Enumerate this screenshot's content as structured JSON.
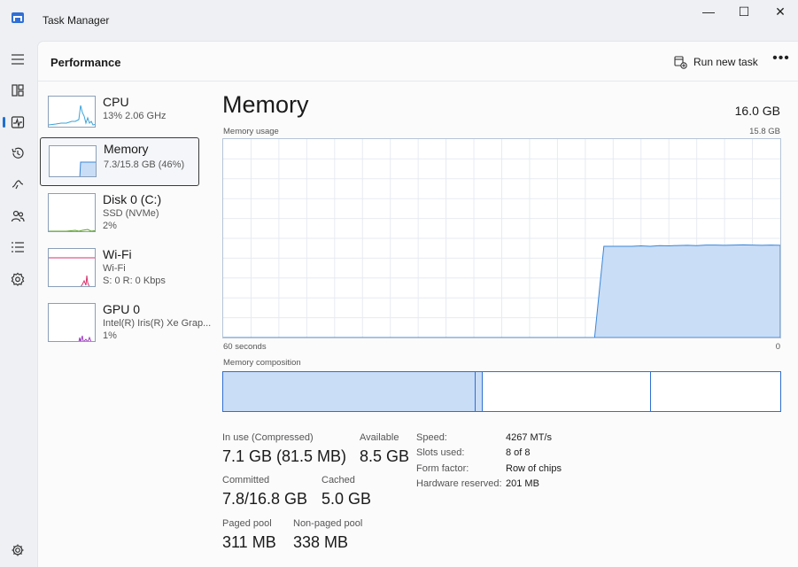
{
  "window": {
    "title": "Task Manager",
    "minimize_glyph": "—",
    "maximize_glyph": "☐",
    "close_glyph": "✕"
  },
  "nav": {
    "items": [
      {
        "name": "menu-icon"
      },
      {
        "name": "processes-icon"
      },
      {
        "name": "performance-icon",
        "active": true
      },
      {
        "name": "app-history-icon"
      },
      {
        "name": "startup-apps-icon"
      },
      {
        "name": "users-icon"
      },
      {
        "name": "details-icon"
      },
      {
        "name": "services-icon"
      }
    ],
    "settings_icon": "gear-icon"
  },
  "header": {
    "title": "Performance",
    "run_task_label": "Run new task",
    "more_label": "•••"
  },
  "sidebar": {
    "items": [
      {
        "name": "CPU",
        "sub1": "13%  2.06 GHz",
        "sub2": "",
        "sub3": ""
      },
      {
        "name": "Memory",
        "sub1": "7.3/15.8 GB (46%)",
        "sub2": "",
        "sub3": ""
      },
      {
        "name": "Disk 0 (C:)",
        "sub1": "SSD (NVMe)",
        "sub2": "2%",
        "sub3": ""
      },
      {
        "name": "Wi-Fi",
        "sub1": "Wi-Fi",
        "sub2": "S: 0  R: 0 Kbps",
        "sub3": ""
      },
      {
        "name": "GPU 0",
        "sub1": "Intel(R) Iris(R) Xe Grap...",
        "sub2": "1%",
        "sub3": ""
      }
    ]
  },
  "memory": {
    "title": "Memory",
    "total": "16.0 GB",
    "usage_label": "Memory usage",
    "usage_max": "15.8 GB",
    "time_left": "60 seconds",
    "time_right": "0",
    "composition_label": "Memory composition",
    "composition_fractions": {
      "in_use": 0.453,
      "modified": 0.013,
      "standby": 0.302,
      "free": 0.232
    },
    "usage_series_percent": [
      0,
      0,
      0,
      0,
      0,
      0,
      0,
      0,
      0,
      0,
      0,
      0,
      0,
      0,
      0,
      0,
      0,
      0,
      0,
      0,
      0,
      0,
      0,
      0,
      0,
      0,
      0,
      0,
      0,
      0,
      0,
      0,
      0,
      0,
      0,
      0,
      0,
      0,
      0,
      0,
      0,
      46,
      46,
      46,
      46,
      46.2,
      46,
      46.3,
      46.2,
      46.4,
      46.5,
      46.3,
      46.6,
      46.6,
      46.5,
      46.6,
      46.7,
      46.6,
      46.5,
      46.6,
      46.5
    ]
  },
  "stats": {
    "in_use_label": "In use (Compressed)",
    "in_use_value": "7.1 GB (81.5 MB)",
    "available_label": "Available",
    "available_value": "8.5 GB",
    "committed_label": "Committed",
    "committed_value": "7.8/16.8 GB",
    "cached_label": "Cached",
    "cached_value": "5.0 GB",
    "paged_label": "Paged pool",
    "paged_value": "311 MB",
    "nonpaged_label": "Non-paged pool",
    "nonpaged_value": "338 MB"
  },
  "properties": [
    {
      "label": "Speed:",
      "value": "4267 MT/s"
    },
    {
      "label": "Slots used:",
      "value": "8 of 8"
    },
    {
      "label": "Form factor:",
      "value": "Row of chips"
    },
    {
      "label": "Hardware reserved:",
      "value": "201 MB"
    }
  ],
  "colors": {
    "accent": "#1f6fd1",
    "memory_fill": "#c9ddf7",
    "memory_line": "#3a86d8",
    "cpu_line": "#3aa3d9",
    "wifi_line": "#d6336c",
    "gpu_line": "#9c3fbf",
    "disk_line": "#5aa02c"
  }
}
